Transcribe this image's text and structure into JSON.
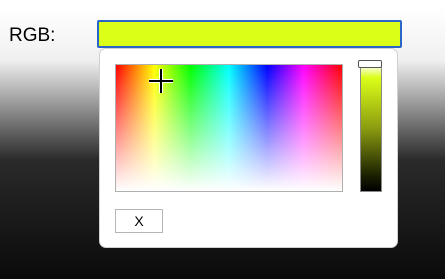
{
  "field": {
    "label": "RGB:",
    "color_value": "#dcff18"
  },
  "picker": {
    "lightness_gradient_top": "#dcff18",
    "close_label": "X"
  },
  "colors": {
    "input_border": "#2a66c8",
    "panel_background": "#ffffff",
    "panel_border": "#d0d0d0"
  },
  "icons": {
    "picker_cursor": "crosshair-icon"
  }
}
